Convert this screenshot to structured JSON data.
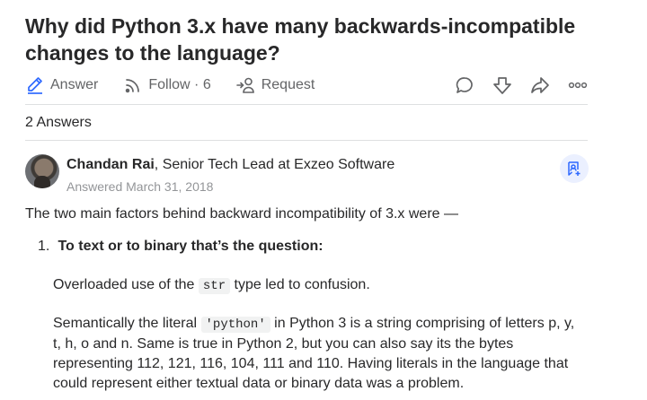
{
  "question": {
    "title": "Why did Python 3.x have many backwards-incompatible changes to the language?"
  },
  "actions": {
    "answer_label": "Answer",
    "follow_label": "Follow · 6",
    "request_label": "Request"
  },
  "answers_count": "2 Answers",
  "answer": {
    "author_name": "Chandan Rai",
    "author_credential": ", Senior Tech Lead at Exzeo Software",
    "answered_date": "Answered March 31, 2018",
    "intro": "The two main factors behind backward incompatibility of 3.x were —",
    "list_number": "1.",
    "list_title": "To text or to binary that’s the question:",
    "para1_before": "Overloaded use of the ",
    "para1_code": "str",
    "para1_after": " type led to confusion.",
    "para2_before": "Semantically the literal ",
    "para2_code": "'python'",
    "para2_after": " in Python 3 is a string comprising of letters p, y, t, h, o and n. Same is true in Python 2, but you can also say its the bytes representing 112, 121, 116, 104, 111 and 110. Having literals in the language that could represent either textual data or binary data was a problem."
  },
  "colors": {
    "accent": "#2e69ff",
    "text": "#282829",
    "muted": "#636466",
    "divider": "#dee0e1"
  }
}
